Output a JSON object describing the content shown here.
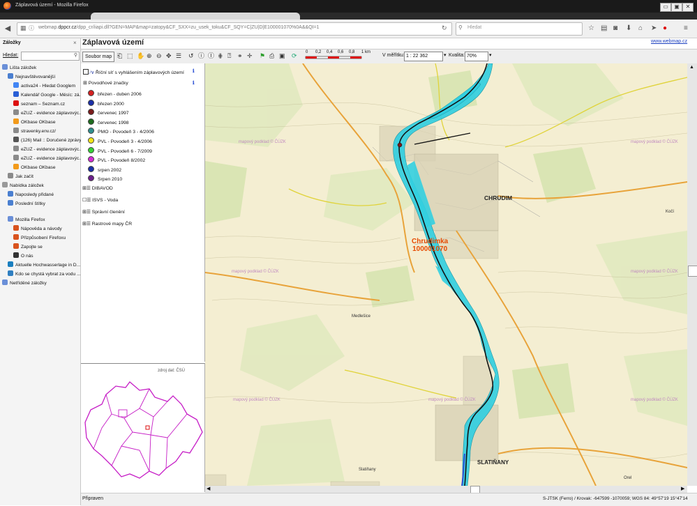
{
  "window": {
    "title": "Záplavová území - Mozilla Firefox",
    "controls": [
      "▭",
      "▣",
      "✕"
    ]
  },
  "browser": {
    "url_prefix": "webmap.",
    "url_domain": "dppcr.cz",
    "url_rest": "/dpp_cr/iiapi.dll?GEN=MAP&map=zatopy&CF_SXX=zu_usek_toku&CF_SQY=C|ZU|D|E100001070%0A&&QI=1",
    "search_placeholder": "Hledat"
  },
  "sidebar": {
    "title": "Záložky",
    "search_label": "Hledat:",
    "items": [
      {
        "label": "Lišta záložek",
        "level": 0,
        "icon": "bookmark-folder-icon"
      },
      {
        "label": "Nejnavštěvovanější",
        "level": 1,
        "icon": "smart-folder-icon"
      },
      {
        "label": "activa24 - Hledat Googlem",
        "level": 2,
        "icon": "google-icon"
      },
      {
        "label": "Kalendář Google - Měsíc: zá...",
        "level": 2,
        "icon": "calendar-icon"
      },
      {
        "label": "seznam – Seznam.cz",
        "level": 2,
        "icon": "seznam-icon"
      },
      {
        "label": "eZUZ - evidence záplavovýc...",
        "level": 2,
        "icon": "globe-icon"
      },
      {
        "label": "OKbase OKbase",
        "level": 2,
        "icon": "okbase-icon"
      },
      {
        "label": "stravenky.env.cz/",
        "level": 2,
        "icon": "globe-icon"
      },
      {
        "label": "(126) Mail :: Doručené zprávy",
        "level": 2,
        "icon": "mail-icon"
      },
      {
        "label": "eZUZ - evidence záplavovýc...",
        "level": 2,
        "icon": "globe-icon"
      },
      {
        "label": "eZUZ - evidence záplavovýc...",
        "level": 2,
        "icon": "globe-icon"
      },
      {
        "label": "OKbase OKbase",
        "level": 2,
        "icon": "okbase-icon"
      },
      {
        "label": "Jak začít",
        "level": 1,
        "icon": "globe-icon"
      },
      {
        "label": "Nabídka záložek",
        "level": 0,
        "icon": "menu-folder-icon"
      },
      {
        "label": "Naposledy přidané",
        "level": 1,
        "icon": "smart-folder-icon"
      },
      {
        "label": "Poslední štítky",
        "level": 1,
        "icon": "smart-folder-icon"
      },
      {
        "label": "Mozilla Firefox",
        "level": 1,
        "icon": "bookmark-folder-icon"
      },
      {
        "label": "Nápověda a návody",
        "level": 2,
        "icon": "firefox-icon"
      },
      {
        "label": "Přizpůsobení Firefoxu",
        "level": 2,
        "icon": "firefox-icon"
      },
      {
        "label": "Zapojte se",
        "level": 2,
        "icon": "firefox-icon"
      },
      {
        "label": "O nás",
        "level": 2,
        "icon": "mozilla-icon"
      },
      {
        "label": "Aktuelle Hochwasserlage in D...",
        "level": 1,
        "icon": "wave-icon"
      },
      {
        "label": "Kdo se chystá vybrat za vodu ...",
        "level": 1,
        "icon": "news-icon"
      },
      {
        "label": "Netříděné záložky",
        "level": 0,
        "icon": "bookmark-folder-icon"
      }
    ]
  },
  "app": {
    "title": "Záplavová území",
    "link": "www.webmap.cz",
    "soubor_map": "Soubor map",
    "scale_ticks": [
      "0",
      "0,2",
      "0,4",
      "0,6",
      "0,8",
      "1 km"
    ],
    "meritko_label": "V měřítku:",
    "meritko_value": "1 : 22 362",
    "kvalita_label": "Kvalita:",
    "kvalita_value": "70%"
  },
  "legend": {
    "river_layer": "Říční síť s vyhlášením záplavových území",
    "flood_marks_group": "Povodňové značky",
    "flood_marks": [
      {
        "label": "březen - duben 2006",
        "color": "#d42020"
      },
      {
        "label": "březen 2000",
        "color": "#1a2fa8"
      },
      {
        "label": "červenec 1997",
        "color": "#7a1b1b"
      },
      {
        "label": "červenec 1998",
        "color": "#1d6b1d"
      },
      {
        "label": "PMO - Povodeň 3 - 4/2006",
        "color": "#2f8f8f"
      },
      {
        "label": "PVL - Povodeň 3 - 4/2006",
        "color": "#f2e51a"
      },
      {
        "label": "PVL - Povodeň 6 - 7/2009",
        "color": "#35d235"
      },
      {
        "label": "PVL - Povodeň 8/2002",
        "color": "#d42ad4"
      },
      {
        "label": "srpen 2002",
        "color": "#1a2fa8"
      },
      {
        "label": "Srpen 2010",
        "color": "#6a1f8a"
      }
    ],
    "groups": [
      "DIBAVOD",
      "ISVS - Voda",
      "Správní členění",
      "Rastrové mapy ČR"
    ]
  },
  "overview": {
    "source": "zdroj dat: ČSÚ"
  },
  "map": {
    "river_name": "Chrudimka",
    "river_code": "100001070",
    "towns": [
      "CHRUDIM",
      "SLATIŇANY",
      "Kočí",
      "Orel",
      "Medlešice",
      "Slatiňany"
    ],
    "watermark": "mapový podklad © ČÚZK",
    "colors": {
      "flood": "#33cfe0",
      "river": "#1a1a1a",
      "label": "#e64a00"
    }
  },
  "status": {
    "left": "Připraven",
    "right": "S-JTSK (Ferro) / Krovak: -647599 -1070059; WGS 84: 49°57'19 15°47'14"
  }
}
